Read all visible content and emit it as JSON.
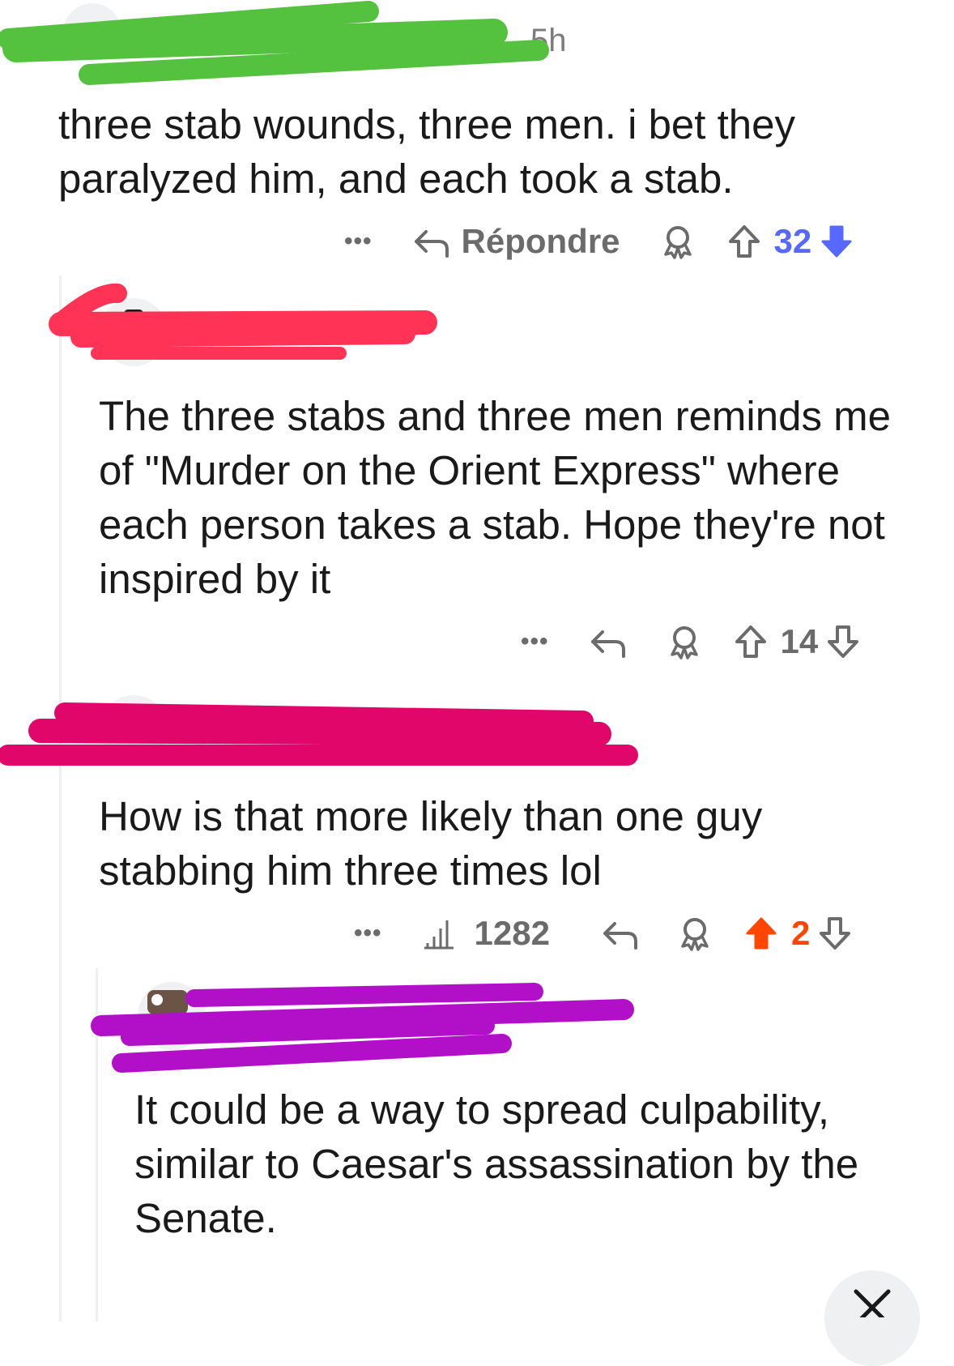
{
  "comments": [
    {
      "time": "5h",
      "body": "three stab wounds, three men. i bet they paralyzed him, and each took a stab.",
      "actions": {
        "more": "•••",
        "reply": "Répondre",
        "score": "32",
        "vote": "down"
      }
    },
    {
      "body": "The three stabs and three men reminds me of \"Murder on the Orient Express\" where each person takes a stab. Hope they're not inspired by it",
      "actions": {
        "more": "•••",
        "score": "14",
        "vote": "none"
      }
    },
    {
      "body": "How is that more likely than one guy stabbing him three times lol",
      "actions": {
        "more": "•••",
        "views": "1282",
        "score": "2",
        "vote": "up"
      }
    },
    {
      "body": "It could be a way to spread culpability, similar to Caesar's assassination by the Senate."
    }
  ],
  "colors": {
    "upvote": "#ff4500",
    "downvote": "#5768ff",
    "redaction_1": "#55c23f",
    "redaction_2": "#ff3355",
    "redaction_3": "#e1076a",
    "redaction_4": "#b10fc8"
  },
  "icons": [
    "reply-icon",
    "award-icon",
    "upvote-icon",
    "downvote-icon",
    "views-icon",
    "close-icon",
    "more-icon"
  ]
}
